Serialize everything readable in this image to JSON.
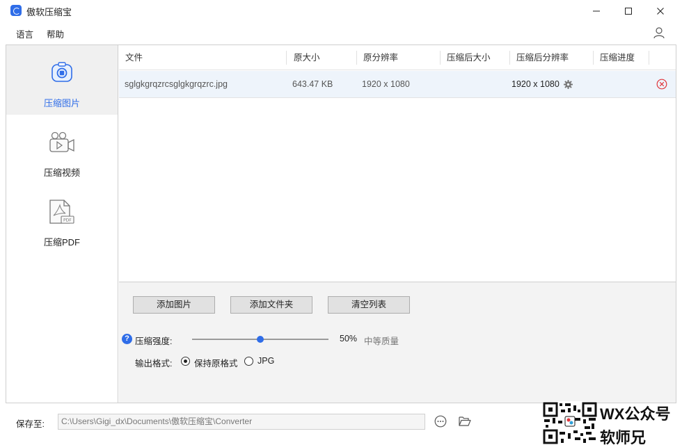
{
  "window": {
    "title": "傲软压缩宝"
  },
  "menu": {
    "items": [
      {
        "label": "语言"
      },
      {
        "label": "帮助"
      }
    ]
  },
  "sidebar": {
    "items": [
      {
        "label": "压缩图片",
        "icon": "image-compress-icon",
        "active": true
      },
      {
        "label": "压缩视频",
        "icon": "video-camera-icon",
        "active": false
      },
      {
        "label": "压缩PDF",
        "icon": "pdf-file-icon",
        "active": false
      }
    ]
  },
  "table": {
    "columns": [
      "文件",
      "原大小",
      "原分辨率",
      "压缩后大小",
      "压缩后分辨率",
      "压缩进度"
    ],
    "rows": [
      {
        "file": "sglgkgrqzrcsglgkgrqzrc.jpg",
        "original_size": "643.47 KB",
        "original_resolution": "1920 x 1080",
        "compressed_size": "",
        "compressed_resolution": "1920 x 1080",
        "progress": ""
      }
    ]
  },
  "actions": {
    "add_images": "添加图片",
    "add_folder": "添加文件夹",
    "clear_list": "清空列表"
  },
  "settings": {
    "strength_label": "压缩强度:",
    "strength_percent": 50,
    "strength_value": "50%",
    "strength_desc": "中等质量",
    "format_label": "输出格式:",
    "format_options": [
      {
        "label": "保持原格式",
        "checked": true
      },
      {
        "label": "JPG",
        "checked": false
      }
    ]
  },
  "footer": {
    "save_label": "保存至:",
    "save_path": "C:\\Users\\Gigi_dx\\Documents\\傲软压缩宝\\Converter"
  },
  "watermark": {
    "line1": "WX公众号",
    "line2": "软师兄"
  },
  "colors": {
    "accent": "#2f6de8",
    "remove": "#e0353b",
    "row_selected": "#eef4fb"
  }
}
